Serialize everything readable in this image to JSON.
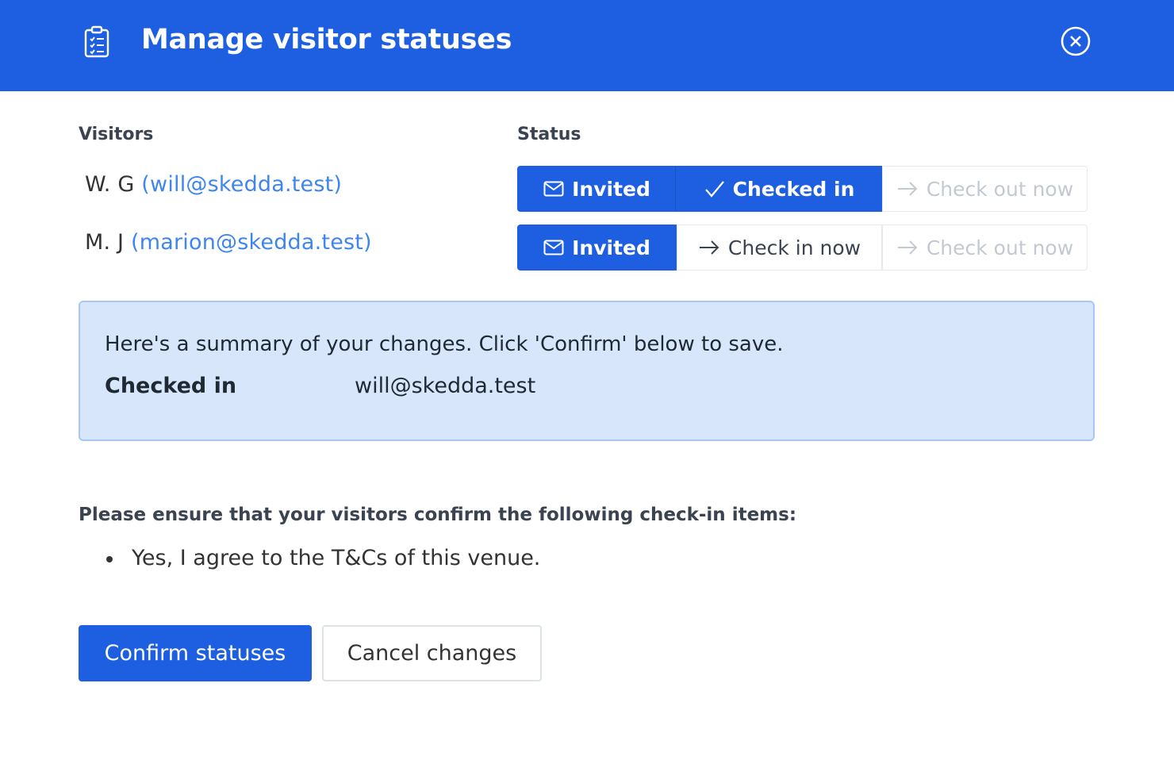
{
  "header": {
    "title": "Manage visitor statuses",
    "icon": "clipboard-icon",
    "close_icon": "close-circle-icon"
  },
  "columns": {
    "visitors": "Visitors",
    "status": "Status"
  },
  "visitors": [
    {
      "name": "W. G",
      "email": "(will@skedda.test)",
      "statuses": {
        "invited": "Invited",
        "checkin": "Checked in",
        "checkout": "Check out now"
      }
    },
    {
      "name": "M. J",
      "email": "(marion@skedda.test)",
      "statuses": {
        "invited": "Invited",
        "checkin": "Check in now",
        "checkout": "Check out now"
      }
    }
  ],
  "summary": {
    "intro": "Here's a summary of your changes. Click 'Confirm' below to save.",
    "status": "Checked in",
    "email": "will@skedda.test"
  },
  "checkin_items": {
    "heading": "Please ensure that your visitors confirm the following check-in items:",
    "items": [
      "Yes, I agree to the T&Cs of this venue."
    ]
  },
  "buttons": {
    "confirm": "Confirm statuses",
    "cancel": "Cancel changes"
  },
  "colors": {
    "primary": "#1d5fe0",
    "link": "#3f86ec",
    "summary_bg": "#d7e6fb"
  }
}
